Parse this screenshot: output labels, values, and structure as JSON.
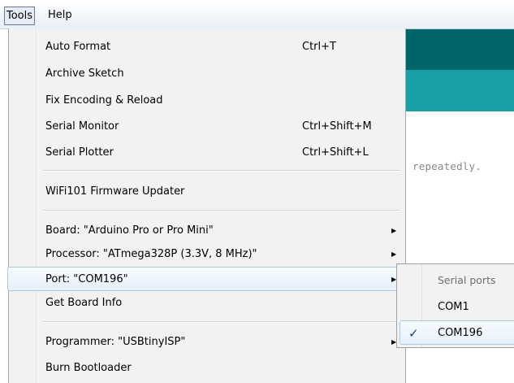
{
  "menubar": {
    "tools": "Tools",
    "help": "Help"
  },
  "editor": {
    "code_text": "repeatedly."
  },
  "tools_menu": {
    "items": [
      {
        "label": "Auto Format",
        "shortcut": "Ctrl+T"
      },
      {
        "label": "Archive Sketch",
        "shortcut": ""
      },
      {
        "label": "Fix Encoding & Reload",
        "shortcut": ""
      },
      {
        "label": "Serial Monitor",
        "shortcut": "Ctrl+Shift+M"
      },
      {
        "label": "Serial Plotter",
        "shortcut": "Ctrl+Shift+L"
      },
      {
        "label": "WiFi101 Firmware Updater",
        "shortcut": ""
      },
      {
        "label": "Board: \"Arduino Pro or Pro Mini\"",
        "shortcut": ""
      },
      {
        "label": "Processor: \"ATmega328P (3.3V, 8 MHz)\"",
        "shortcut": ""
      },
      {
        "label": "Port: \"COM196\"",
        "shortcut": ""
      },
      {
        "label": "Get Board Info",
        "shortcut": ""
      },
      {
        "label": "Programmer: \"USBtinyISP\"",
        "shortcut": ""
      },
      {
        "label": "Burn Bootloader",
        "shortcut": ""
      }
    ]
  },
  "port_submenu": {
    "header": "Serial ports",
    "items": [
      {
        "label": "COM1",
        "checked": false
      },
      {
        "label": "COM196",
        "checked": true
      }
    ],
    "check_glyph": "✓"
  },
  "colors": {
    "editor_header_dark": "#006468",
    "editor_header_light": "#17a1a5",
    "highlight_border": "#a9c8e8"
  }
}
